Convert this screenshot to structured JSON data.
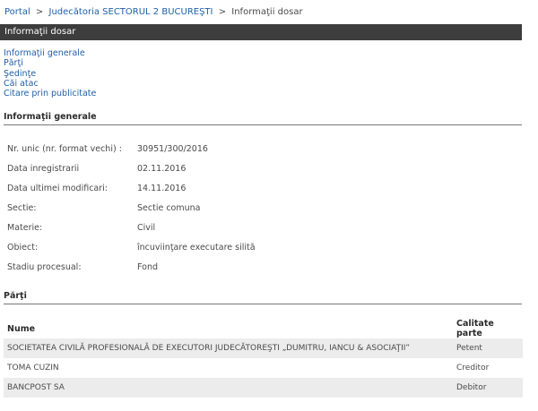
{
  "breadcrumb": {
    "items": [
      "Portal",
      "Judecătoria SECTORUL 2 BUCUREŞTI",
      "Informaţii dosar"
    ],
    "separator": ">"
  },
  "header": {
    "title": "Informaţii dosar"
  },
  "toc": [
    "Informaţii generale",
    "Părţi",
    "Şedinţe",
    "Căi atac",
    "Citare prin publicitate"
  ],
  "sections": {
    "general": "Informaţii generale",
    "parti": "Părţi"
  },
  "general_info": [
    {
      "label": "Nr. unic (nr. format vechi) :",
      "value": "30951/300/2016"
    },
    {
      "label": "Data inregistrarii",
      "value": "02.11.2016"
    },
    {
      "label": "Data ultimei modificari:",
      "value": "14.11.2016"
    },
    {
      "label": "Sectie:",
      "value": "Sectie comuna"
    },
    {
      "label": "Materie:",
      "value": "Civil"
    },
    {
      "label": "Obiect:",
      "value": "încuviinţare executare silită"
    },
    {
      "label": "Stadiu procesual:",
      "value": "Fond"
    }
  ],
  "parti_table": {
    "headers": [
      "Nume",
      "Calitate parte"
    ],
    "rows": [
      [
        "SOCIETATEA CIVILĂ PROFESIONALĂ DE EXECUTORI JUDECĂTOREŞTI „DUMITRU, IANCU & ASOCIAŢII”",
        "Petent"
      ],
      [
        "TOMA CUZIN",
        "Creditor"
      ],
      [
        "BANCPOST SA",
        "Debitor"
      ]
    ]
  }
}
